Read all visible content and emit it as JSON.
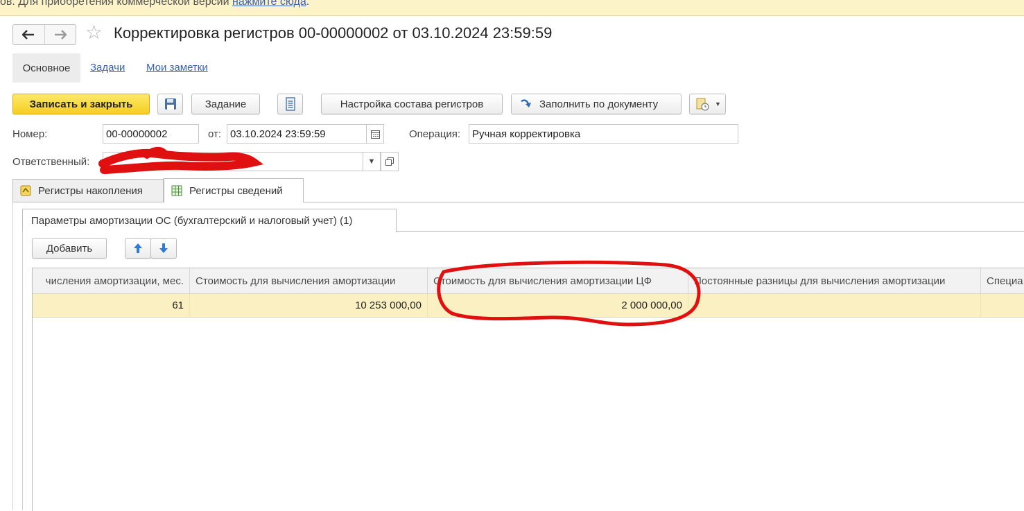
{
  "banner": {
    "text": "ов. Для приобретения коммерческой версии ",
    "link": "нажмите сюда",
    "tail": "."
  },
  "header": {
    "back_icon": "arrow-left-icon",
    "forward_icon": "arrow-right-icon",
    "favorite_icon": "star-icon",
    "title": "Корректировка регистров 00-00000002 от 03.10.2024 23:59:59"
  },
  "sections": [
    {
      "label": "Основное",
      "active": true
    },
    {
      "label": "Задачи",
      "active": false
    },
    {
      "label": "Мои заметки",
      "active": false
    }
  ],
  "toolbar": {
    "save_close": "Записать и закрыть",
    "save_icon": "floppy-disk-icon",
    "task": "Задание",
    "report_icon": "list-document-icon",
    "register_setup": "Настройка состава регистров",
    "fill_icon": "curved-arrow-icon",
    "fill_by_doc": "Заполнить по документу",
    "more_icon": "document-clock-icon",
    "dropdown_icon": "chevron-down-icon"
  },
  "form": {
    "number_label": "Номер:",
    "number_value": "00-00000002",
    "date_label": "от:",
    "date_value": "03.10.2024 23:59:59",
    "operation_label": "Операция:",
    "operation_value": "Ручная корректировка",
    "responsible_label": "Ответственный:",
    "responsible_value_tail": "а"
  },
  "register_tabs": [
    {
      "label": "Регистры накопления",
      "icon": "accumulation-register-icon"
    },
    {
      "label": "Регистры сведений",
      "icon": "info-register-grid-icon"
    }
  ],
  "subtab": {
    "label": "Параметры амортизации ОС (бухгалтерский и налоговый учет) (1)"
  },
  "table_toolbar": {
    "add": "Добавить",
    "up_icon": "arrow-up-icon",
    "down_icon": "arrow-down-icon"
  },
  "table": {
    "columns": [
      "числения амортизации, мес.",
      "Стоимость для вычисления амортизации",
      "Стоимость для вычисления амортизации ЦФ",
      "Постоянные разницы для вычисления амортизации",
      "Специа"
    ],
    "rows": [
      [
        "61",
        "10 253 000,00",
        "2 000 000,00",
        "",
        ""
      ]
    ]
  },
  "colors": {
    "banner_bg": "#fcf3c9",
    "primary_button": "#f5cf20",
    "selected_row": "#fbf0c2",
    "link": "#3b63b5",
    "annotation_red": "#e01010"
  }
}
